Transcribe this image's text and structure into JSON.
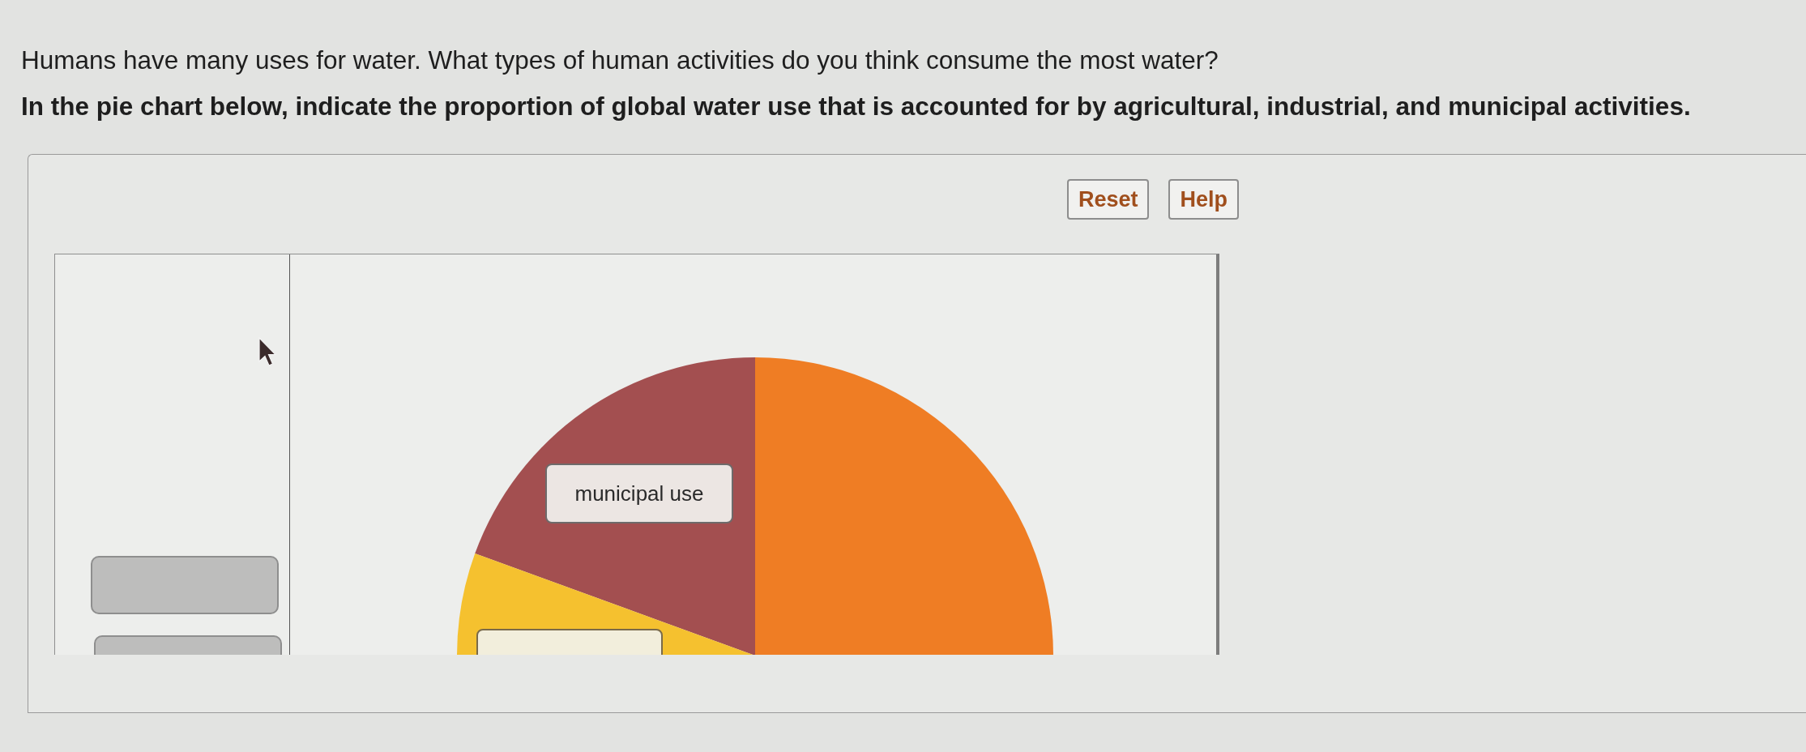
{
  "prompt": "Humans have many uses for water. What types of human activities do you think consume the most water?",
  "instruction": "In the pie chart below, indicate the proportion of global water use that is accounted for by agricultural, industrial, and municipal activities.",
  "toolbar": {
    "buttons": [
      {
        "label": "Reset"
      },
      {
        "label": "Help"
      }
    ]
  },
  "chart": {
    "slices": [
      {
        "color": "#a34f50"
      },
      {
        "color": "#ef7d24"
      },
      {
        "color": "#f5c12f"
      }
    ],
    "labels": [
      {
        "text": "municipal use"
      }
    ]
  }
}
